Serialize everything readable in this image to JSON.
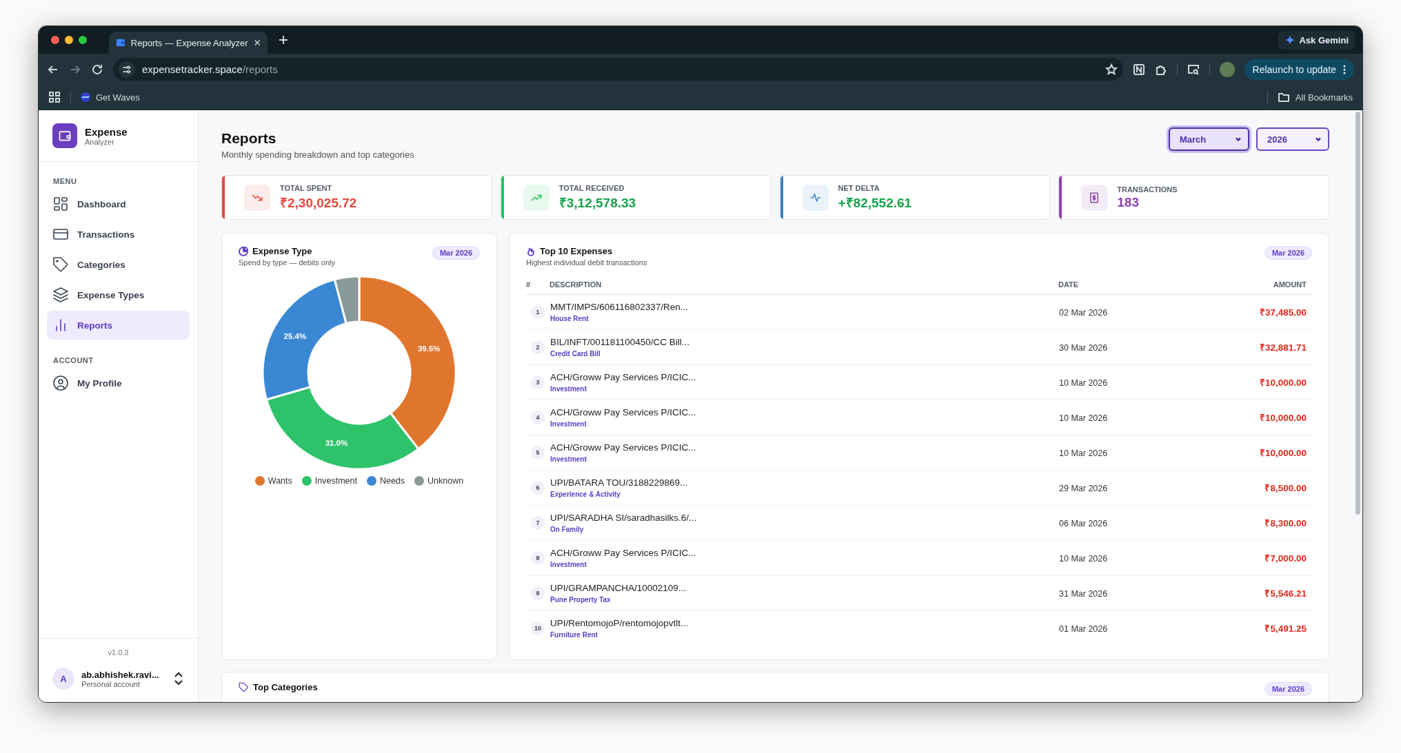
{
  "browser": {
    "tab": {
      "title": "Reports — Expense Analyzer",
      "selected": true
    },
    "ask_gemini": "Ask Gemini",
    "url": {
      "host": "expensetracker.space",
      "path": "/reports"
    },
    "relaunch": "Relaunch to update",
    "bookmarks": [
      {
        "label": "Get Waves"
      }
    ],
    "all_bookmarks": "All Bookmarks"
  },
  "brand": {
    "title": "Expense",
    "subtitle": "Analyzer"
  },
  "sidebar": {
    "sections": [
      {
        "heading": "MENU",
        "items": [
          {
            "label": "Dashboard",
            "selected": false
          },
          {
            "label": "Transactions",
            "selected": false
          },
          {
            "label": "Categories",
            "selected": false
          },
          {
            "label": "Expense Types",
            "selected": false
          },
          {
            "label": "Reports",
            "selected": true
          }
        ]
      },
      {
        "heading": "ACCOUNT",
        "items": [
          {
            "label": "My Profile",
            "selected": false
          }
        ]
      }
    ],
    "version": "v1.0.3",
    "user": {
      "initial": "A",
      "name": "ab.abhishek.ravi...",
      "subtitle": "Personal account"
    }
  },
  "header": {
    "title": "Reports",
    "subtitle": "Monthly spending breakdown and top categories",
    "filters": [
      {
        "value": "March",
        "focused": true
      },
      {
        "value": "2026",
        "focused": false
      }
    ]
  },
  "stats": [
    {
      "label": "TOTAL SPENT",
      "value": {
        "text": "₹2,30,025.72",
        "color": "#e5483b"
      },
      "color": "#e5483b"
    },
    {
      "label": "TOTAL RECEIVED",
      "value": {
        "text": "₹3,12,578.33",
        "color": "#16a34a"
      },
      "color": "#22c55e"
    },
    {
      "label": "NET DELTA",
      "value": {
        "text": "+₹82,552.61",
        "color": "#16a34a"
      },
      "color": "#3b82c4"
    },
    {
      "label": "TRANSACTIONS",
      "value": {
        "text": "183",
        "color": "#8e44ad"
      },
      "color": "#8e44ad"
    }
  ],
  "expense_type": {
    "title": "Expense Type",
    "subtitle": "Spend by type — debits only",
    "badge": "Mar 2026",
    "chart_data": {
      "type": "donut",
      "categories": [
        "Wants",
        "Investment",
        "Needs",
        "Unknown"
      ],
      "colors": [
        "#e0762e",
        "#2ec26a",
        "#3a88d4",
        "#8a9a99"
      ],
      "values": [
        39.5,
        31.0,
        25.4,
        4.1
      ],
      "legend": "bottom",
      "value_labels": [
        "39.5%",
        "31.0%",
        "25.4%",
        null
      ]
    }
  },
  "top_expenses": {
    "title": "Top 10 Expenses",
    "subtitle": "Highest individual debit transactions",
    "badge": "Mar 2026",
    "columns": [
      "#",
      "DESCRIPTION",
      "DATE",
      "AMOUNT"
    ],
    "rows": [
      {
        "rank": "1",
        "description": "MMT/IMPS/606116802337/Ren...",
        "category": "House Rent",
        "date": "02 Mar 2026",
        "amount": "₹37,485.00"
      },
      {
        "rank": "2",
        "description": "BIL/INFT/001181100450/CC Bill...",
        "category": "Credit Card Bill",
        "date": "30 Mar 2026",
        "amount": "₹32,881.71"
      },
      {
        "rank": "3",
        "description": "ACH/Groww Pay Services P/ICIC...",
        "category": "Investment",
        "date": "10 Mar 2026",
        "amount": "₹10,000.00"
      },
      {
        "rank": "4",
        "description": "ACH/Groww Pay Services P/ICIC...",
        "category": "Investment",
        "date": "10 Mar 2026",
        "amount": "₹10,000.00"
      },
      {
        "rank": "5",
        "description": "ACH/Groww Pay Services P/ICIC...",
        "category": "Investment",
        "date": "10 Mar 2026",
        "amount": "₹10,000.00"
      },
      {
        "rank": "6",
        "description": "UPI/BATARA TOU/3188229869...",
        "category": "Experience & Activity",
        "date": "29 Mar 2026",
        "amount": "₹8,500.00"
      },
      {
        "rank": "7",
        "description": "UPI/SARADHA SI/saradhasilks.6/...",
        "category": "On Family",
        "date": "06 Mar 2026",
        "amount": "₹8,300.00"
      },
      {
        "rank": "8",
        "description": "ACH/Groww Pay Services P/ICIC...",
        "category": "Investment",
        "date": "10 Mar 2026",
        "amount": "₹7,000.00"
      },
      {
        "rank": "9",
        "description": "UPI/GRAMPANCHA/10002109...",
        "category": "Pune Property Tax",
        "date": "31 Mar 2026",
        "amount": "₹5,546.21"
      },
      {
        "rank": "10",
        "description": "UPI/RentomojoP/rentomojopvtlt...",
        "category": "Furniture Rent",
        "date": "01 Mar 2026",
        "amount": "₹5,491.25"
      }
    ]
  },
  "top_categories": {
    "title": "Top Categories",
    "badge": "Mar 2026"
  }
}
